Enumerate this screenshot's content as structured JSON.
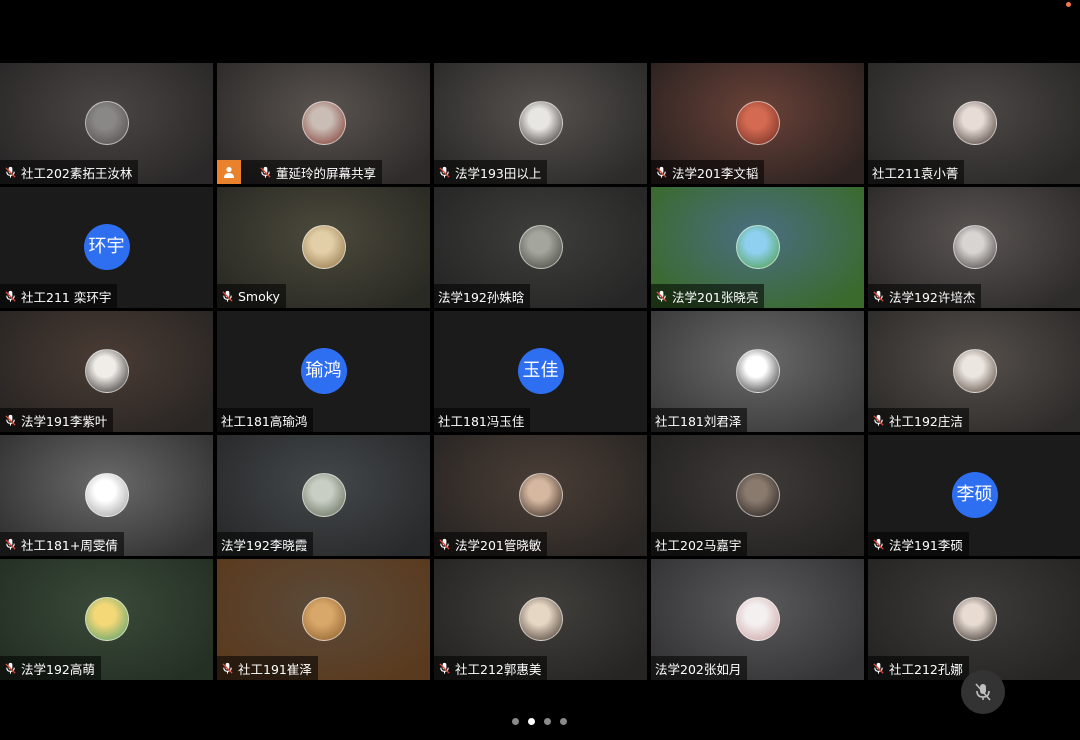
{
  "meeting": {
    "participants": [
      {
        "name": "社工202素拓王汝林",
        "muted": true,
        "avatar": "cat-photo-avatar",
        "bg": [
          "#4a4644",
          "#2a2828"
        ],
        "av": [
          "#8a8886",
          "#4b4746"
        ]
      },
      {
        "name": "董延玲的屏幕共享",
        "muted": true,
        "screen_share": true,
        "avatar": "flowers-photo-avatar",
        "bg": [
          "#5a5450",
          "#2e2b2a"
        ],
        "av": [
          "#c9bdb5",
          "#7a3028"
        ]
      },
      {
        "name": "法学193田以上",
        "muted": true,
        "avatar": "person-photo-avatar",
        "bg": [
          "#56524e",
          "#2c2b2a"
        ],
        "av": [
          "#e8e6e2",
          "#2a2624"
        ]
      },
      {
        "name": "法学201李文韬",
        "muted": true,
        "avatar": "food-photo-avatar",
        "bg": [
          "#6a4238",
          "#2d2321"
        ],
        "av": [
          "#d46a52",
          "#6a2a20"
        ]
      },
      {
        "name": "社工211袁小菁",
        "muted": false,
        "avatar": "selfie-photo-avatar",
        "bg": [
          "#4c4846",
          "#2a2928"
        ],
        "av": [
          "#e8ddd6",
          "#3a2c28"
        ]
      },
      {
        "name": "社工211 栾环宇",
        "muted": true,
        "initials": "环宇",
        "bg": [
          "#1b1b1b",
          "#1b1b1b"
        ]
      },
      {
        "name": "Smoky",
        "muted": true,
        "avatar": "dog-photo-avatar",
        "bg": [
          "#4c4a3c",
          "#2a2a24"
        ],
        "av": [
          "#e2cfa8",
          "#8c6e3e"
        ]
      },
      {
        "name": "法学192孙姝晗",
        "muted": false,
        "avatar": "tree-photo-avatar",
        "bg": [
          "#3e3e3c",
          "#262626"
        ],
        "av": [
          "#a4a59c",
          "#3c3f36"
        ]
      },
      {
        "name": "法学201张晓亮",
        "muted": true,
        "avatar": "landscape-photo-avatar",
        "bg": [
          "#4a6e82",
          "#3a6a2c"
        ],
        "av": [
          "#8fd0f0",
          "#4a9a3a"
        ]
      },
      {
        "name": "法学192许培杰",
        "muted": true,
        "avatar": "portrait-photo-avatar",
        "bg": [
          "#5a5452",
          "#2e2c2b"
        ],
        "av": [
          "#d8d4d2",
          "#3a3432"
        ]
      },
      {
        "name": "法学191李紫叶",
        "muted": true,
        "avatar": "girl-photo-avatar",
        "bg": [
          "#4a3c34",
          "#2a2624"
        ],
        "av": [
          "#f0ece8",
          "#1e1a18"
        ]
      },
      {
        "name": "社工181高瑜鸿",
        "muted": false,
        "initials": "瑜鸿",
        "bg": [
          "#1b1b1b",
          "#1b1b1b"
        ]
      },
      {
        "name": "社工181冯玉佳",
        "muted": false,
        "initials": "玉佳",
        "bg": [
          "#1b1b1b",
          "#1b1b1b"
        ]
      },
      {
        "name": "社工181刘君泽",
        "muted": false,
        "avatar": "cartoon-cat-avatar",
        "bg": [
          "#6a6a6a",
          "#3a3a3a"
        ],
        "av": [
          "#ffffff",
          "#222222"
        ]
      },
      {
        "name": "社工192庄洁",
        "muted": true,
        "avatar": "boy-photo-avatar",
        "bg": [
          "#56504c",
          "#2e2c2a"
        ],
        "av": [
          "#ece6e0",
          "#4a3a30"
        ]
      },
      {
        "name": "社工181+周雯倩",
        "muted": true,
        "avatar": "sketch-girl-avatar",
        "bg": [
          "#6a6a6a",
          "#333333"
        ],
        "av": [
          "#ffffff",
          "#9a9a9a"
        ]
      },
      {
        "name": "法学192李晓霞",
        "muted": false,
        "avatar": "leaves-photo-avatar",
        "bg": [
          "#44484a",
          "#282a2b"
        ],
        "av": [
          "#c8cec4",
          "#5a6450"
        ]
      },
      {
        "name": "法学201管晓敏",
        "muted": true,
        "avatar": "woman-photo-avatar",
        "bg": [
          "#4a3e36",
          "#2a2624"
        ],
        "av": [
          "#d6b8a0",
          "#2a1e18"
        ]
      },
      {
        "name": "社工202马嘉宇",
        "muted": false,
        "avatar": "sunglasses-photo-avatar",
        "bg": [
          "#3e3a38",
          "#242322"
        ],
        "av": [
          "#8a7a6e",
          "#1e1a18"
        ]
      },
      {
        "name": "法学191李硕",
        "muted": true,
        "initials": "李硕",
        "bg": [
          "#1b1b1b",
          "#1b1b1b"
        ]
      },
      {
        "name": "法学192高萌",
        "muted": true,
        "avatar": "anime-girl-avatar",
        "bg": [
          "#3a4a3a",
          "#243024"
        ],
        "av": [
          "#f4d878",
          "#4a9a6a"
        ]
      },
      {
        "name": "社工191崔泽",
        "muted": true,
        "avatar": "monkey-photo-avatar",
        "bg": [
          "#5a4a3a",
          "#5a3a1e"
        ],
        "av": [
          "#d8a86a",
          "#8a5a2a"
        ]
      },
      {
        "name": "社工212郭惠美",
        "muted": true,
        "avatar": "woman2-photo-avatar",
        "bg": [
          "#42403c",
          "#262524"
        ],
        "av": [
          "#e6d6c4",
          "#3a2e26"
        ]
      },
      {
        "name": "法学202张如月",
        "muted": false,
        "avatar": "sheep-photo-avatar",
        "bg": [
          "#5a5a5c",
          "#343436"
        ],
        "av": [
          "#f4f0f0",
          "#c89a9a"
        ]
      },
      {
        "name": "社工212孔娜",
        "muted": true,
        "avatar": "girl2-photo-avatar",
        "bg": [
          "#3e3c3a",
          "#262524"
        ],
        "av": [
          "#e8dcd2",
          "#2a221e"
        ]
      }
    ]
  },
  "pager": {
    "pages": 4,
    "current": 2
  },
  "controls": {
    "mute_icon": "mic-muted-icon"
  }
}
